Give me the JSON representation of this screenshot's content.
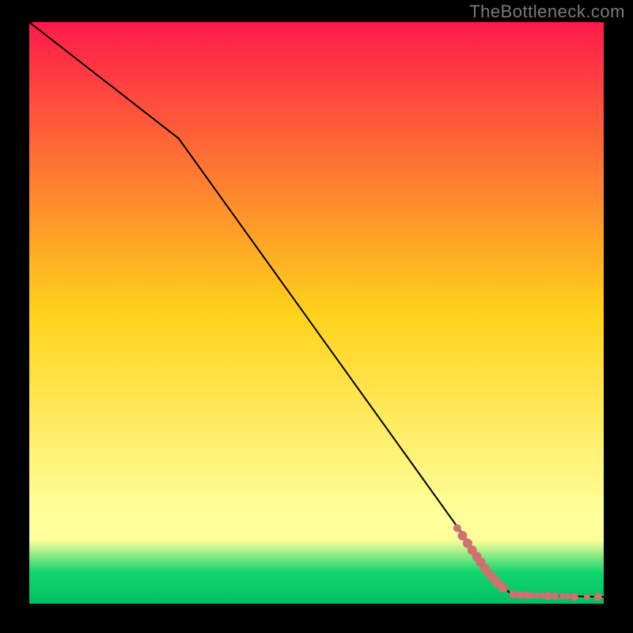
{
  "watermark": "TheBottleneck.com",
  "colors": {
    "top": "#ff1a4b",
    "mid": "#ffd21a",
    "pale": "#ffff9a",
    "green": "#14d66e",
    "bottom": "#00bf63",
    "line": "#000000",
    "marker": "#cf7171"
  },
  "chart_data": {
    "type": "line",
    "title": "",
    "xlabel": "",
    "ylabel": "",
    "xlim": [
      0,
      100
    ],
    "ylim": [
      0,
      100
    ],
    "series": [
      {
        "name": "curve",
        "style": "line",
        "color_key": "line",
        "points": [
          {
            "x": 0,
            "y": 100
          },
          {
            "x": 26,
            "y": 80
          },
          {
            "x": 80.5,
            "y": 5
          },
          {
            "x": 84,
            "y": 1.5
          },
          {
            "x": 100,
            "y": 1.2
          }
        ]
      },
      {
        "name": "markers-diagonal",
        "style": "marker",
        "color_key": "marker",
        "points": [
          {
            "x": 74.5,
            "y": 13.0,
            "r": 5
          },
          {
            "x": 75.4,
            "y": 11.7,
            "r": 6
          },
          {
            "x": 76.3,
            "y": 10.4,
            "r": 6
          },
          {
            "x": 77.1,
            "y": 9.2,
            "r": 6
          },
          {
            "x": 77.9,
            "y": 8.1,
            "r": 6
          },
          {
            "x": 78.6,
            "y": 7.1,
            "r": 6
          },
          {
            "x": 79.3,
            "y": 6.1,
            "r": 6
          },
          {
            "x": 80.0,
            "y": 5.2,
            "r": 6
          },
          {
            "x": 80.8,
            "y": 4.3,
            "r": 6
          },
          {
            "x": 81.6,
            "y": 3.5,
            "r": 6
          },
          {
            "x": 82.5,
            "y": 2.7,
            "r": 6
          }
        ]
      },
      {
        "name": "markers-flat",
        "style": "marker",
        "color_key": "marker",
        "points": [
          {
            "x": 84.2,
            "y": 1.6,
            "r": 5
          },
          {
            "x": 85.4,
            "y": 1.5,
            "r": 5
          },
          {
            "x": 86.6,
            "y": 1.5,
            "r": 5
          },
          {
            "x": 87.5,
            "y": 1.4,
            "r": 4
          },
          {
            "x": 88.4,
            "y": 1.4,
            "r": 4
          },
          {
            "x": 89.4,
            "y": 1.4,
            "r": 4
          },
          {
            "x": 90.3,
            "y": 1.3,
            "r": 5
          },
          {
            "x": 91.5,
            "y": 1.3,
            "r": 5
          },
          {
            "x": 92.8,
            "y": 1.3,
            "r": 4
          },
          {
            "x": 93.7,
            "y": 1.3,
            "r": 4
          },
          {
            "x": 94.9,
            "y": 1.2,
            "r": 5
          },
          {
            "x": 97.1,
            "y": 1.2,
            "r": 4
          },
          {
            "x": 99.0,
            "y": 1.2,
            "r": 5
          }
        ]
      }
    ],
    "background_gradient_stops": [
      {
        "offset": 0.0,
        "key": "top"
      },
      {
        "offset": 0.5,
        "key": "mid"
      },
      {
        "offset": 0.84,
        "key": "pale"
      },
      {
        "offset": 0.89,
        "key": "pale"
      },
      {
        "offset": 0.945,
        "key": "green"
      },
      {
        "offset": 1.0,
        "key": "bottom"
      }
    ]
  }
}
